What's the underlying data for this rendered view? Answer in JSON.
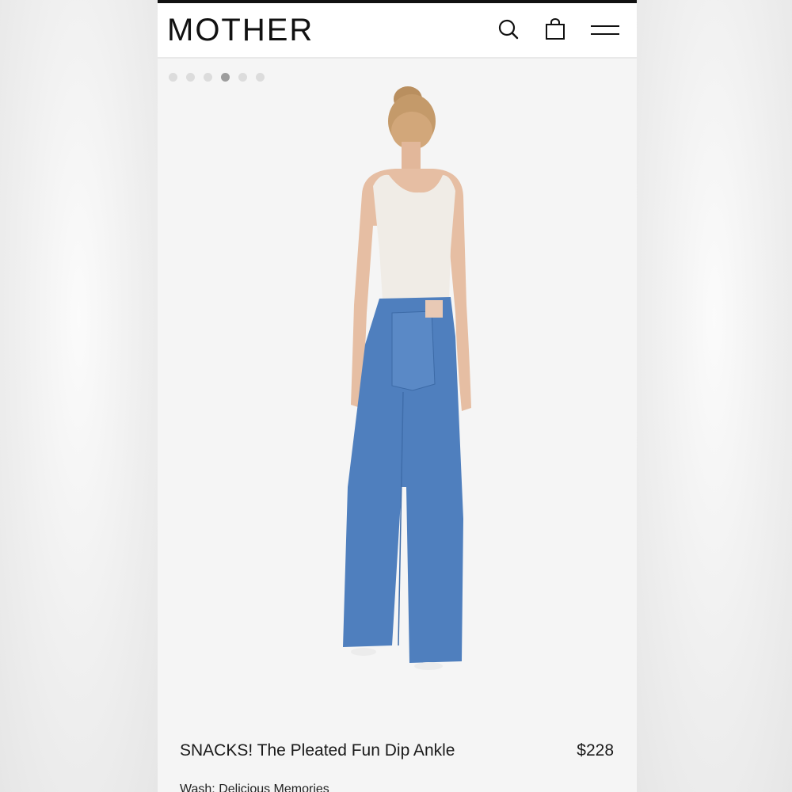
{
  "header": {
    "logo_text": "MOTHER",
    "search_icon": "search-icon",
    "bag_icon": "shopping-bag-icon",
    "menu_icon": "hamburger-menu-icon"
  },
  "carousel": {
    "dot_count": 6,
    "active_index": 3
  },
  "product": {
    "image_description_icon": "product-photo",
    "title": "SNACKS! The Pleated Fun Dip Ankle",
    "price": "$228",
    "wash": "Wash: Delicious Memories"
  },
  "colors": {
    "topbar": "#111111",
    "denim": "#4f7fbe",
    "tank_top": "#f0ece6",
    "dot_active": "#9d9d9d",
    "dot_inactive": "#dcdcdc"
  }
}
